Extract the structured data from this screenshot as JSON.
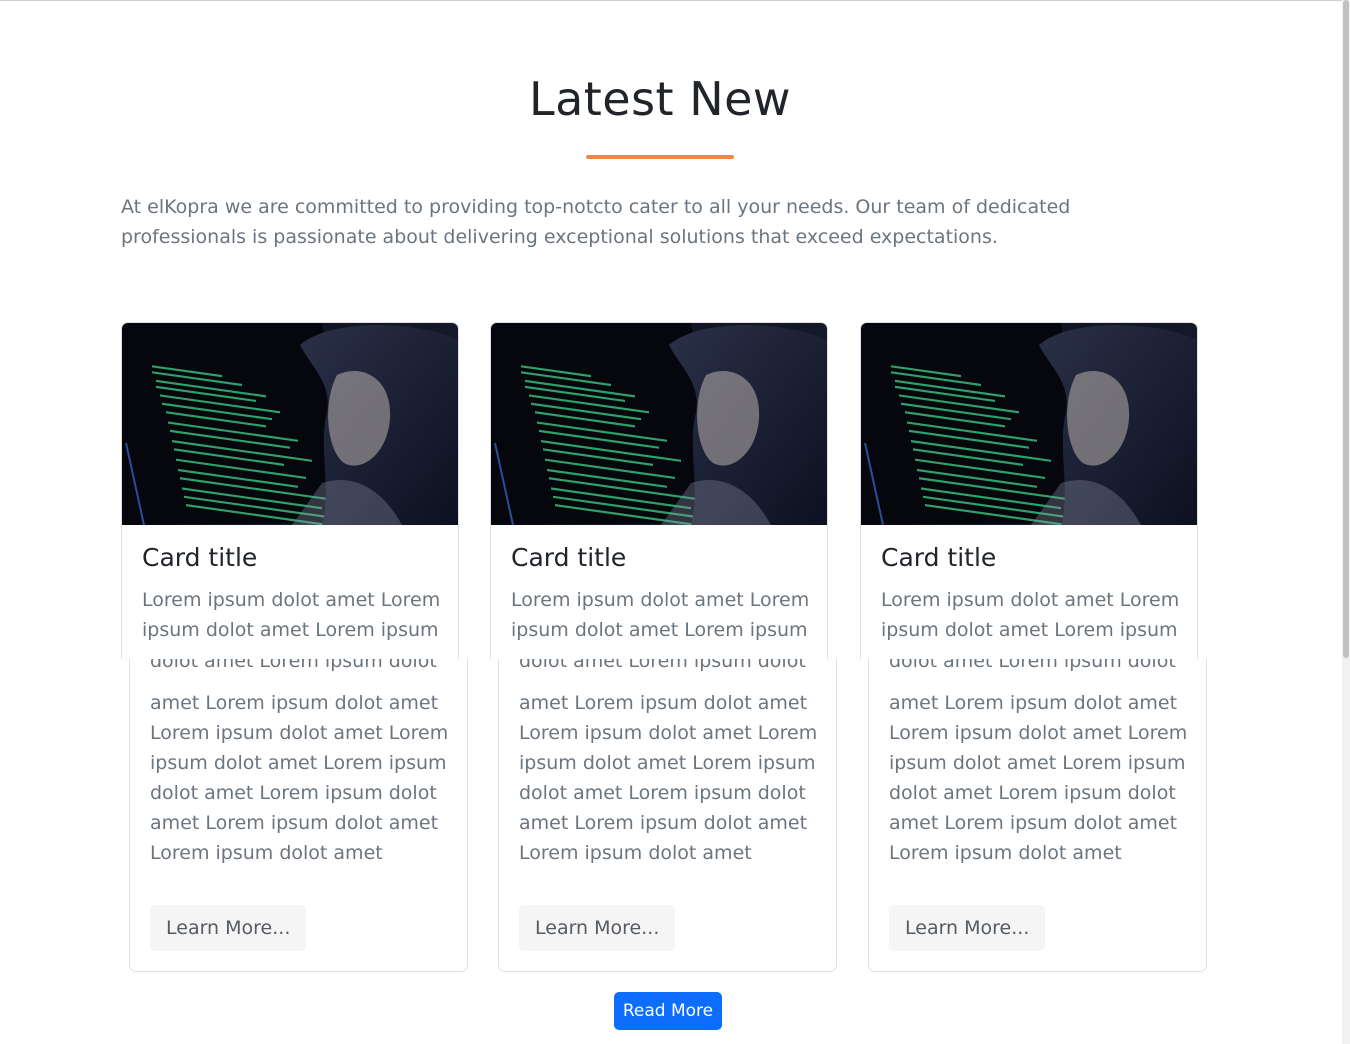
{
  "section": {
    "title": "Latest New",
    "intro": "At elKopra we are committed to providing top-notcto cater to all your needs. Our team of dedicated professionals is passionate about delivering exceptional solutions that exceed expectations.",
    "accent_color": "#e88a4e"
  },
  "cards": [
    {
      "image": "hooded-hacker-at-computer",
      "title": "Card title",
      "text_top": "Lorem ipsum dolot amet Lorem ipsum dolot amet Lorem ipsum",
      "text_clipped": "dolot amet Lorem ipsum dolot",
      "text_bottom": "amet Lorem ipsum dolot amet Lorem ipsum dolot amet Lorem ipsum dolot amet Lorem ipsum dolot amet Lorem ipsum dolot amet Lorem ipsum dolot amet Lorem ipsum dolot amet",
      "button": "Learn More..."
    },
    {
      "image": "hooded-hacker-at-computer",
      "title": "Card title",
      "text_top": "Lorem ipsum dolot amet Lorem ipsum dolot amet Lorem ipsum",
      "text_clipped": "dolot amet Lorem ipsum dolot",
      "text_bottom": "amet Lorem ipsum dolot amet Lorem ipsum dolot amet Lorem ipsum dolot amet Lorem ipsum dolot amet Lorem ipsum dolot amet Lorem ipsum dolot amet Lorem ipsum dolot amet",
      "button": "Learn More..."
    },
    {
      "image": "hooded-hacker-at-computer",
      "title": "Card title",
      "text_top": "Lorem ipsum dolot amet Lorem ipsum dolot amet Lorem ipsum",
      "text_clipped": "dolot amet Lorem ipsum dolot",
      "text_bottom": "amet Lorem ipsum dolot amet Lorem ipsum dolot amet Lorem ipsum dolot amet Lorem ipsum dolot amet Lorem ipsum dolot amet Lorem ipsum dolot amet Lorem ipsum dolot amet",
      "button": "Learn More..."
    }
  ],
  "read_more": {
    "label": "Read More",
    "color": "#0d6efd"
  }
}
